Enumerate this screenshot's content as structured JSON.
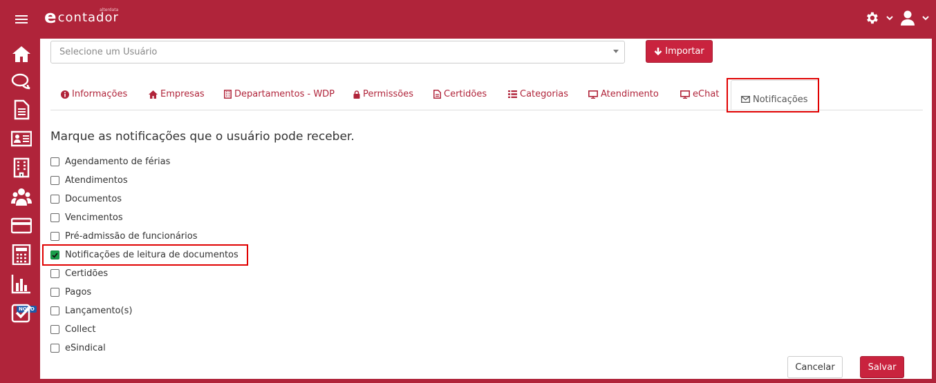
{
  "app": {
    "logo_text": "contador",
    "logo_letter": "e",
    "logo_sub": "alterdata"
  },
  "user_select": {
    "placeholder": "Selecione um Usuário"
  },
  "import_button": {
    "label": "Importar"
  },
  "tabs": [
    {
      "label": "Informações",
      "icon": "info-circle-icon"
    },
    {
      "label": "Empresas",
      "icon": "home-icon"
    },
    {
      "label": "Departamentos - WDP",
      "icon": "building-icon"
    },
    {
      "label": "Permissões",
      "icon": "lock-icon"
    },
    {
      "label": "Certidões",
      "icon": "document-icon"
    },
    {
      "label": "Categorias",
      "icon": "list-icon"
    },
    {
      "label": "Atendimento",
      "icon": "monitor-icon"
    },
    {
      "label": "eChat",
      "icon": "monitor-icon"
    },
    {
      "label": "Notificações",
      "icon": "envelope-icon",
      "active": true
    }
  ],
  "notifications": {
    "intro": "Marque as notificações que o usuário pode receber.",
    "options": [
      {
        "label": "Agendamento de férias",
        "checked": false
      },
      {
        "label": "Atendimentos",
        "checked": false
      },
      {
        "label": "Documentos",
        "checked": false
      },
      {
        "label": "Vencimentos",
        "checked": false
      },
      {
        "label": "Pré-admissão de funcionários",
        "checked": false
      },
      {
        "label": "Notificações de leitura de documentos",
        "checked": true
      },
      {
        "label": "Certidões",
        "checked": false
      },
      {
        "label": "Pagos",
        "checked": false
      },
      {
        "label": "Lançamento(s)",
        "checked": false
      },
      {
        "label": "Collect",
        "checked": false
      },
      {
        "label": "eSindical",
        "checked": false
      }
    ]
  },
  "sidebar": {
    "items": [
      "home-icon",
      "chat-icon",
      "document-icon",
      "id-card-icon",
      "building-icon",
      "users-icon",
      "credit-card-icon",
      "calculator-icon",
      "bar-chart-icon",
      "check-square-icon"
    ],
    "badge": "NOVO"
  },
  "footer": {
    "cancel_label": "Cancelar",
    "save_label": "Salvar"
  },
  "colors": {
    "brand": "#b0243a",
    "button": "#c9233e",
    "checked": "#1a9e4a",
    "highlight": "#e00000"
  }
}
